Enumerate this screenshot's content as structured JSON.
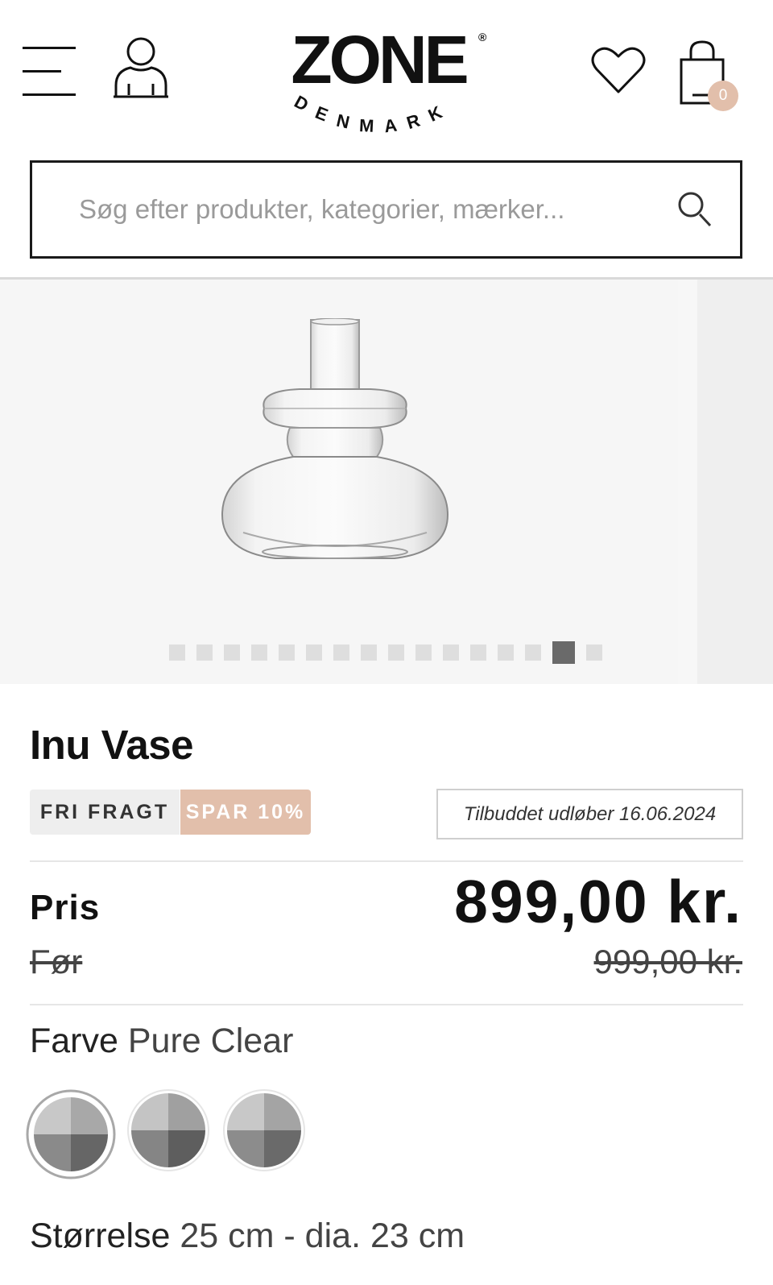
{
  "header": {
    "logo_main": "ZONE",
    "logo_reg": "®",
    "logo_sub": "DENMARK",
    "cart_count": "0",
    "icons": [
      "menu-icon",
      "user-icon",
      "heart-icon",
      "shopping-bag-icon"
    ]
  },
  "search": {
    "placeholder": "Søg efter produkter, kategorier, mærker..."
  },
  "gallery": {
    "slide_count": 16,
    "active_index": 14
  },
  "product": {
    "title": "Inu Vase",
    "badge_free": "FRI FRAGT",
    "badge_save": "SPAR 10%",
    "offer_text": "Tilbuddet udløber 16.06.2024",
    "price_label": "Pris",
    "price": "899,00 kr.",
    "before_label": "Før",
    "before_price": "999,00 kr.",
    "color_label": "Farve",
    "color_value": "Pure Clear",
    "size_label": "Størrelse",
    "size_value": "25 cm - dia. 23 cm"
  },
  "colors": {
    "accent": "#e2bfab",
    "border": "#1a1a1a",
    "gallery_bg": "#f6f6f6"
  }
}
